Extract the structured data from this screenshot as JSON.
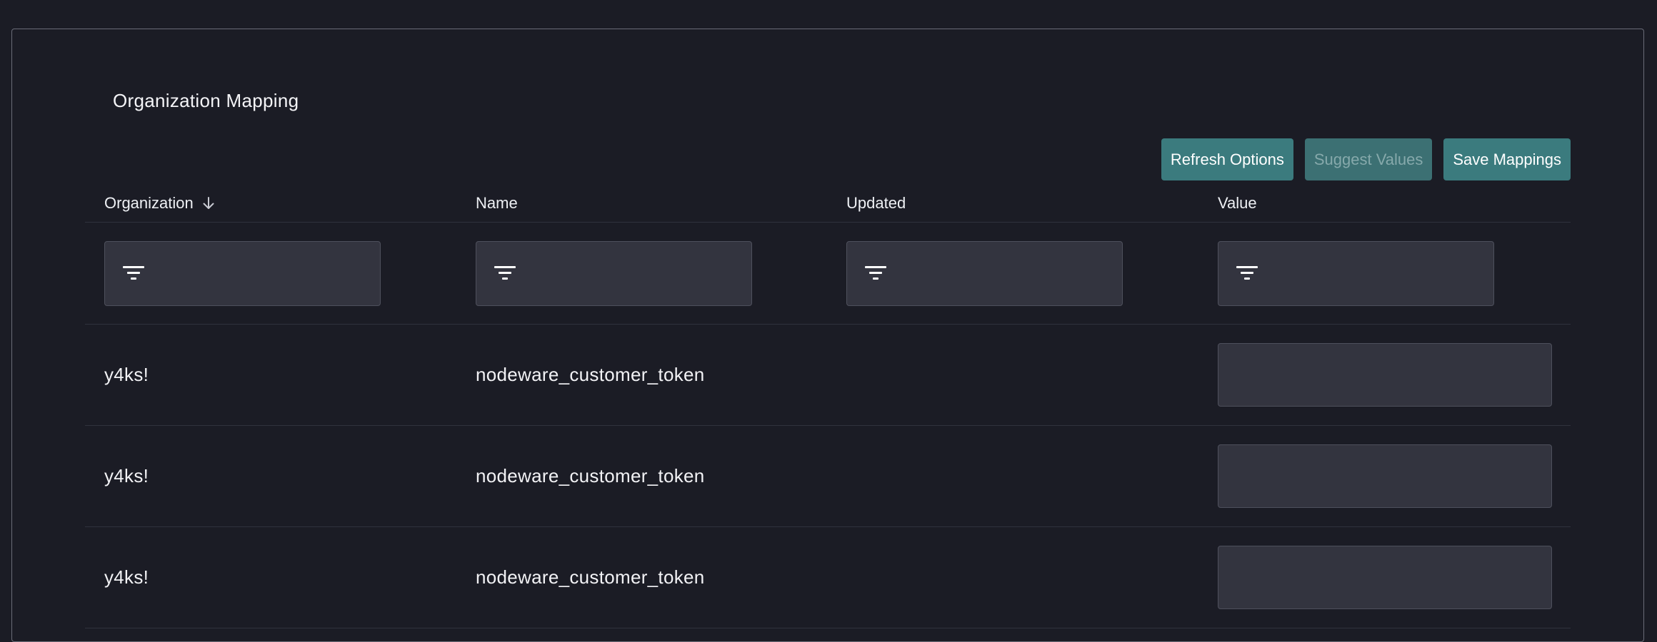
{
  "page": {
    "title": "Organization Mapping"
  },
  "toolbar": {
    "refresh_label": "Refresh Options",
    "suggest_label": "Suggest Values",
    "save_label": "Save Mappings"
  },
  "table": {
    "columns": [
      {
        "label": "Organization",
        "sorted": "descending"
      },
      {
        "label": "Name"
      },
      {
        "label": "Updated"
      },
      {
        "label": "Value"
      }
    ],
    "filters": [
      {
        "value": "",
        "icon": "filter-icon"
      },
      {
        "value": "",
        "icon": "filter-icon"
      },
      {
        "value": "",
        "icon": "filter-icon"
      },
      {
        "value": "",
        "icon": "filter-icon"
      }
    ],
    "rows": [
      {
        "organization": "y4ks!",
        "name": "nodeware_customer_token",
        "updated": "",
        "value": ""
      },
      {
        "organization": "y4ks!",
        "name": "nodeware_customer_token",
        "updated": "",
        "value": ""
      },
      {
        "organization": "y4ks!",
        "name": "nodeware_customer_token",
        "updated": "",
        "value": ""
      }
    ]
  },
  "colors": {
    "background": "#1b1c25",
    "accent_button": "#3b7b7e",
    "input_bg": "#33343f"
  }
}
